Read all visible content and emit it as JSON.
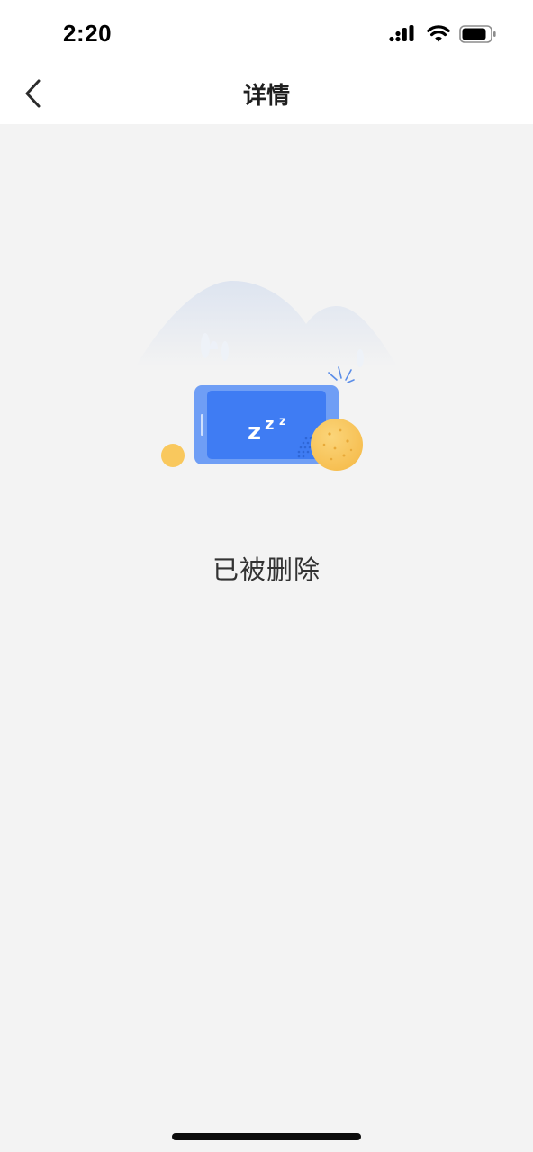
{
  "status_bar": {
    "time": "2:20",
    "icons": [
      "cellular-signal-icon",
      "wifi-icon",
      "battery-icon"
    ]
  },
  "nav": {
    "back_icon": "chevron-left-icon",
    "title": "详情"
  },
  "empty_state": {
    "illustration": "sleeping-phone-illustration",
    "text": "已被删除"
  },
  "colors": {
    "header_bg": "#ffffff",
    "page_bg": "#f3f3f3",
    "phone_blue": "#3d7bf5",
    "phone_frame": "#6a9cf7",
    "coin_yellow": "#f9c85d",
    "mountain": "#e3e8f2"
  }
}
